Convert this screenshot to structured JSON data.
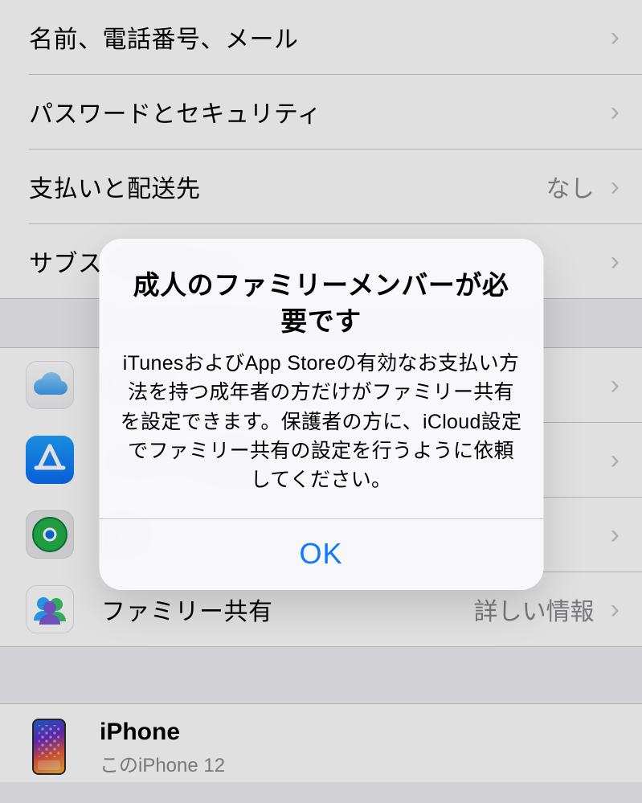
{
  "group1": {
    "row1": {
      "label": "名前、電話番号、メール"
    },
    "row2": {
      "label": "パスワードとセキュリティ"
    },
    "row3": {
      "label": "支払いと配送先",
      "detail": "なし"
    },
    "row4": {
      "label": "サブスクリプション"
    }
  },
  "group2": {
    "row1": {
      "label": "iCloud"
    },
    "row2": {
      "label": "メディアと購入"
    },
    "row3": {
      "label": "探す"
    },
    "row4": {
      "label": "ファミリー共有",
      "detail": "詳しい情報"
    }
  },
  "group3": {
    "device": {
      "title": "iPhone",
      "sub": "このiPhone 12"
    }
  },
  "alert": {
    "title": "成人のファミリーメンバーが必要です",
    "message": "iTunesおよびApp Storeの有効なお支払い方法を持つ成年者の方だけがファミリー共有を設定できます。保護者の方に、iCloud設定でファミリー共有の設定を行うように依頼してください。",
    "ok": "OK"
  }
}
